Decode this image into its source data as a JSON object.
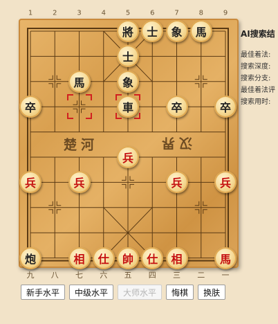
{
  "board": {
    "top_coords": [
      "1",
      "2",
      "3",
      "4",
      "5",
      "6",
      "7",
      "8",
      "9"
    ],
    "bottom_coords": [
      "九",
      "八",
      "七",
      "六",
      "五",
      "四",
      "三",
      "二",
      "一"
    ],
    "river_left": "楚河",
    "river_right": "汉界",
    "last_move": {
      "from": [
        2,
        3
      ],
      "to": [
        4,
        3
      ]
    },
    "pieces": [
      {
        "ch": "將",
        "side": "black",
        "col": 4,
        "row": 0
      },
      {
        "ch": "士",
        "side": "black",
        "col": 5,
        "row": 0
      },
      {
        "ch": "象",
        "side": "black",
        "col": 6,
        "row": 0
      },
      {
        "ch": "馬",
        "side": "black",
        "col": 7,
        "row": 0
      },
      {
        "ch": "士",
        "side": "black",
        "col": 4,
        "row": 1
      },
      {
        "ch": "馬",
        "side": "black",
        "col": 2,
        "row": 2
      },
      {
        "ch": "象",
        "side": "black",
        "col": 4,
        "row": 2
      },
      {
        "ch": "卒",
        "side": "black",
        "col": 0,
        "row": 3
      },
      {
        "ch": "車",
        "side": "black",
        "col": 4,
        "row": 3
      },
      {
        "ch": "卒",
        "side": "black",
        "col": 6,
        "row": 3
      },
      {
        "ch": "卒",
        "side": "black",
        "col": 8,
        "row": 3
      },
      {
        "ch": "兵",
        "side": "red",
        "col": 4,
        "row": 5
      },
      {
        "ch": "兵",
        "side": "red",
        "col": 0,
        "row": 6
      },
      {
        "ch": "兵",
        "side": "red",
        "col": 2,
        "row": 6
      },
      {
        "ch": "兵",
        "side": "red",
        "col": 6,
        "row": 6
      },
      {
        "ch": "兵",
        "side": "red",
        "col": 8,
        "row": 6
      },
      {
        "ch": "炮",
        "side": "black",
        "col": 0,
        "row": 9
      },
      {
        "ch": "相",
        "side": "red",
        "col": 2,
        "row": 9
      },
      {
        "ch": "仕",
        "side": "red",
        "col": 3,
        "row": 9
      },
      {
        "ch": "帥",
        "side": "red",
        "col": 4,
        "row": 9
      },
      {
        "ch": "仕",
        "side": "red",
        "col": 5,
        "row": 9
      },
      {
        "ch": "相",
        "side": "red",
        "col": 6,
        "row": 9
      },
      {
        "ch": "馬",
        "side": "red",
        "col": 8,
        "row": 9
      }
    ]
  },
  "panel": {
    "title": "AI搜索结",
    "rows": [
      "最佳着法:",
      "搜索深度:",
      "搜索分支:",
      "最佳着法评",
      "搜索用时:"
    ]
  },
  "buttons": [
    {
      "label": "新手水平",
      "enabled": true
    },
    {
      "label": "中级水平",
      "enabled": true
    },
    {
      "label": "大师水平",
      "enabled": false
    },
    {
      "label": "悔棋",
      "enabled": true
    },
    {
      "label": "换肤",
      "enabled": true
    }
  ]
}
